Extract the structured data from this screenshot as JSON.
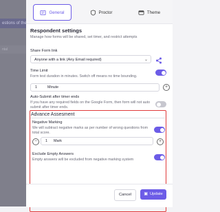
{
  "background": {
    "highlight_text": "estions of the ...",
    "row_text": "ntal"
  },
  "tabs": [
    {
      "label": "General",
      "icon": "form-icon",
      "active": true
    },
    {
      "label": "Proctor",
      "icon": "shield-icon",
      "active": false
    },
    {
      "label": "Theme",
      "icon": "theme-icon",
      "active": false
    }
  ],
  "settings": {
    "title": "Respondent settings",
    "subtitle": "Manage how forms will be shared, set timer, and restrict attempts"
  },
  "share": {
    "label": "Share Form link",
    "selected": "Anyone with a link (Any Email required)"
  },
  "time_limit": {
    "label": "Time Limit",
    "description": "Form test duration in minutes. Switch off means no time bounding.",
    "value": "1",
    "unit": "Minute",
    "enabled": true
  },
  "auto_submit": {
    "label": "Auto-Submit after timer ends",
    "description": "If you have any required fields on the Google Form, then form will not auto submit after timer ends.",
    "enabled": false
  },
  "advance": {
    "title": "Advance Assesment",
    "negative_marking": {
      "label": "Negative Marking",
      "description": "We will subtract negative marks as per number of wrong questions from total score.",
      "value": "1",
      "unit": "Mark",
      "enabled": true
    },
    "exclude_empty": {
      "label": "Exclude Empty Answers",
      "description": "Empty answers will be excluded from negative marking system",
      "enabled": true
    }
  },
  "footer": {
    "cancel_label": "Cancel",
    "update_label": "Update"
  },
  "colors": {
    "accent": "#6c5ce7",
    "highlight_border": "#e03a3a"
  }
}
